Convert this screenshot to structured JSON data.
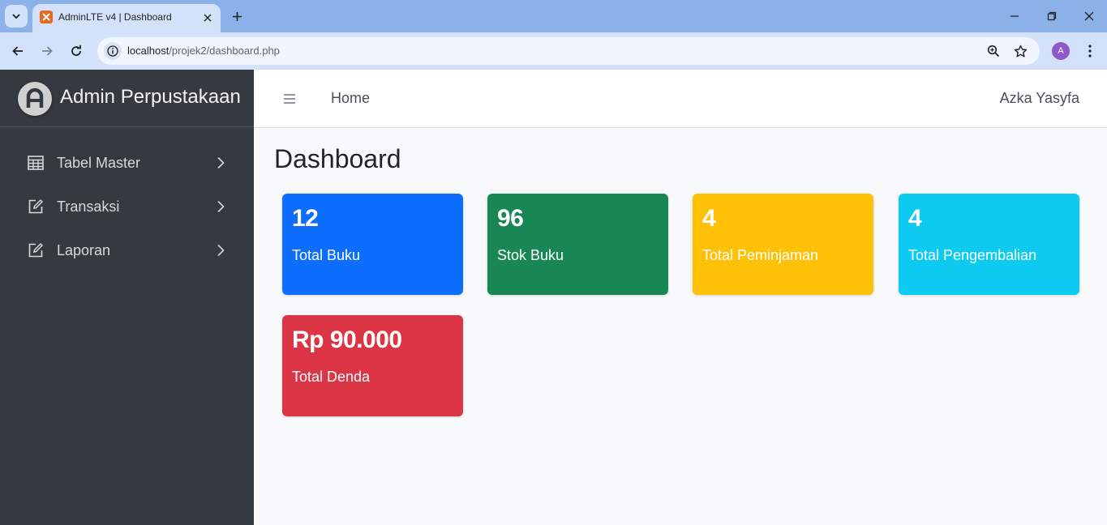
{
  "browser": {
    "tab_title": "AdminLTE v4 | Dashboard",
    "url_host": "localhost",
    "url_path": "/projek2/dashboard.php",
    "profile_initial": "A"
  },
  "sidebar": {
    "brand": "Admin Perpustakaan",
    "items": [
      {
        "label": "Tabel Master",
        "icon": "table-icon"
      },
      {
        "label": "Transaksi",
        "icon": "edit-icon"
      },
      {
        "label": "Laporan",
        "icon": "edit-icon"
      }
    ]
  },
  "topbar": {
    "home_label": "Home",
    "user_name": "Azka Yasyfa"
  },
  "main": {
    "title": "Dashboard",
    "cards": [
      {
        "value": "12",
        "label": "Total Buku",
        "color": "#0d6efd"
      },
      {
        "value": "96",
        "label": "Stok Buku",
        "color": "#198754"
      },
      {
        "value": "4",
        "label": "Total Peminjaman",
        "color": "#ffc107"
      },
      {
        "value": "4",
        "label": "Total Pengembalian",
        "color": "#0dcaf0"
      },
      {
        "value": "Rp 90.000",
        "label": "Total Denda",
        "color": "#dc3545"
      }
    ]
  }
}
